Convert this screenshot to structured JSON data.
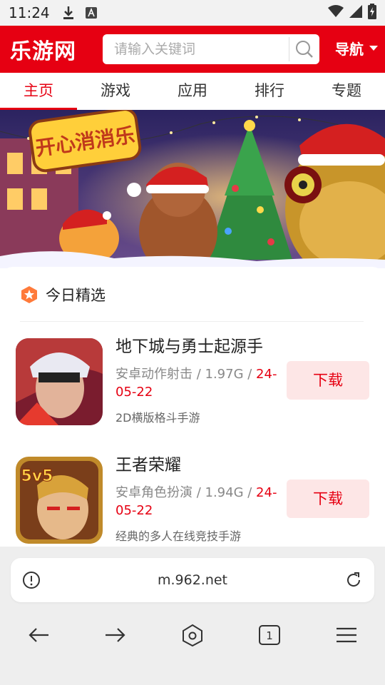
{
  "status_bar": {
    "time": "11:24",
    "icons": [
      "download-icon",
      "a-badge-icon",
      "wifi-icon",
      "signal-icon",
      "battery-icon"
    ]
  },
  "header": {
    "logo": "乐游网",
    "search_placeholder": "请输入关键词",
    "nav_label": "导航"
  },
  "tabs": [
    {
      "label": "主页",
      "active": true
    },
    {
      "label": "游戏",
      "active": false
    },
    {
      "label": "应用",
      "active": false
    },
    {
      "label": "排行",
      "active": false
    },
    {
      "label": "专题",
      "active": false
    }
  ],
  "banner": {
    "title_art": "开心消消乐"
  },
  "section": {
    "title": "今日精选"
  },
  "apps": [
    {
      "name": "地下城与勇士起源手",
      "meta": "安卓动作射击 / 1.97G / ",
      "date": "24-05-22",
      "desc": "2D横版格斗手游",
      "button": "下载"
    },
    {
      "name": "王者荣耀",
      "meta": "安卓角色扮演 / 1.94G / ",
      "date": "24-05-22",
      "desc": "经典的多人在线竞技手游",
      "button": "下载",
      "icon_text": "5v5"
    }
  ],
  "browser": {
    "url": "m.962.net",
    "tab_count": "1"
  },
  "colors": {
    "brand": "#e60012",
    "download_bg": "#fde6e6"
  }
}
